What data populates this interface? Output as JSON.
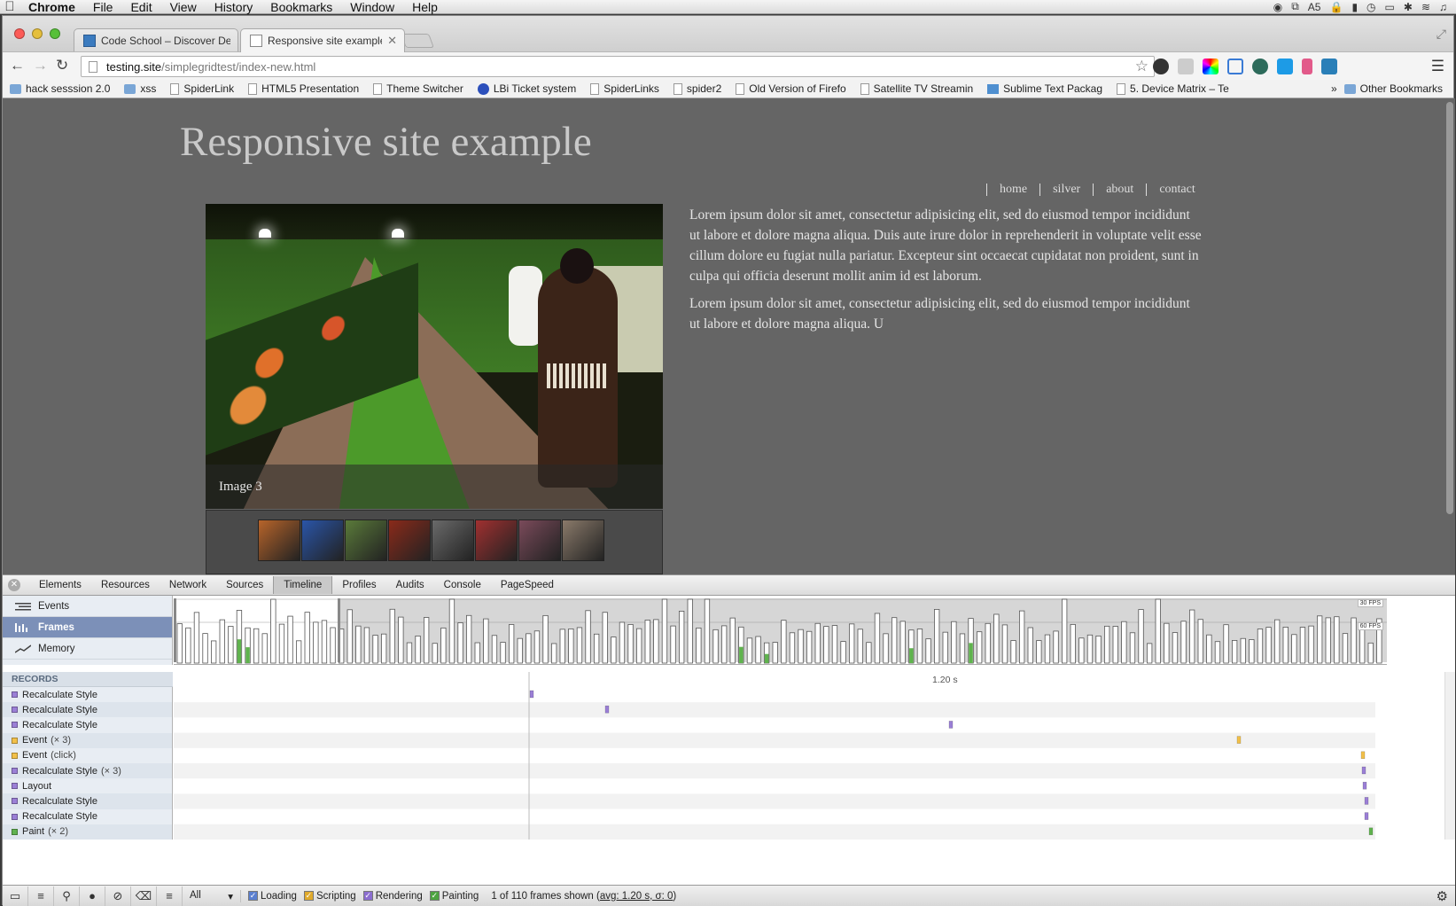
{
  "menubar": {
    "app": "Chrome",
    "items": [
      "File",
      "Edit",
      "View",
      "History",
      "Bookmarks",
      "Window",
      "Help"
    ],
    "status_badge": "5"
  },
  "tabs": [
    {
      "title": "Code School – Discover De",
      "active": false
    },
    {
      "title": "Responsive site example",
      "active": true
    }
  ],
  "omnibox": {
    "host": "testing.site",
    "path": "/simplegridtest/index-new.html"
  },
  "bookmarks": [
    {
      "label": "hack sesssion 2.0",
      "icon": "folder"
    },
    {
      "label": "xss",
      "icon": "folder"
    },
    {
      "label": "SpiderLink",
      "icon": "page"
    },
    {
      "label": "HTML5 Presentation",
      "icon": "page"
    },
    {
      "label": "Theme Switcher",
      "icon": "page"
    },
    {
      "label": "LBi Ticket system",
      "icon": "globe"
    },
    {
      "label": "SpiderLinks",
      "icon": "page"
    },
    {
      "label": "spider2",
      "icon": "page"
    },
    {
      "label": "Old Version of Firefo",
      "icon": "page"
    },
    {
      "label": "Satellite TV Streamin",
      "icon": "page"
    },
    {
      "label": "Sublime Text Packag",
      "icon": "sq"
    },
    {
      "label": "5. Device Matrix – Te",
      "icon": "page"
    }
  ],
  "bookmarks_more": "»",
  "bookmarks_other": "Other Bookmarks",
  "site": {
    "title": "Responsive site example",
    "nav": [
      "home",
      "silver",
      "about",
      "contact"
    ],
    "hero_caption": "Image 3",
    "thumb_colors": [
      "#b7642a",
      "#2a55a8",
      "#5a7a3a",
      "#8a2a1a",
      "#6a6a6a",
      "#a03030",
      "#7a4a5a",
      "#8a7a6a"
    ],
    "paragraphs": [
      "Lorem ipsum dolor sit amet, consectetur adipisicing elit, sed do eiusmod tempor incididunt ut labore et dolore magna aliqua. Duis aute irure dolor in reprehenderit in voluptate velit esse cillum dolore eu fugiat nulla pariatur. Excepteur sint occaecat cupidatat non proident, sunt in culpa qui officia deserunt mollit anim id est laborum.",
      "Lorem ipsum dolor sit amet, consectetur adipisicing elit, sed do eiusmod tempor incididunt ut labore et dolore magna aliqua. U"
    ]
  },
  "devtools": {
    "tabs": [
      "Elements",
      "Resources",
      "Network",
      "Sources",
      "Timeline",
      "Profiles",
      "Audits",
      "Console",
      "PageSpeed"
    ],
    "active_tab": "Timeline",
    "timeline_modes": [
      "Events",
      "Frames",
      "Memory"
    ],
    "active_mode": "Frames",
    "fps_labels": [
      "30 FPS",
      "60 FPS"
    ],
    "records_header": "RECORDS",
    "time_marker": "1.20 s",
    "records": [
      {
        "name": "Recalculate Style",
        "count": "",
        "color": "#9b7fd6"
      },
      {
        "name": "Recalculate Style",
        "count": "",
        "color": "#9b7fd6"
      },
      {
        "name": "Recalculate Style",
        "count": "",
        "color": "#9b7fd6"
      },
      {
        "name": "Event",
        "count": "(× 3)",
        "color": "#f2c04a"
      },
      {
        "name": "Event",
        "count": "(click)",
        "color": "#f2c04a"
      },
      {
        "name": "Recalculate Style",
        "count": "(× 3)",
        "color": "#9b7fd6"
      },
      {
        "name": "Layout",
        "count": "",
        "color": "#9b7fd6"
      },
      {
        "name": "Recalculate Style",
        "count": "",
        "color": "#9b7fd6"
      },
      {
        "name": "Recalculate Style",
        "count": "",
        "color": "#9b7fd6"
      },
      {
        "name": "Paint",
        "count": "(× 2)",
        "color": "#60b24f"
      }
    ],
    "filter": "All",
    "categories": [
      {
        "label": "Loading",
        "color": "#5a7fd0"
      },
      {
        "label": "Scripting",
        "color": "#e0aa2c"
      },
      {
        "label": "Rendering",
        "color": "#8b6dd0"
      },
      {
        "label": "Painting",
        "color": "#4ea341"
      }
    ],
    "frames_info": "1 of 110 frames shown",
    "frames_stats": "avg: 1.20 s, σ: 0"
  }
}
